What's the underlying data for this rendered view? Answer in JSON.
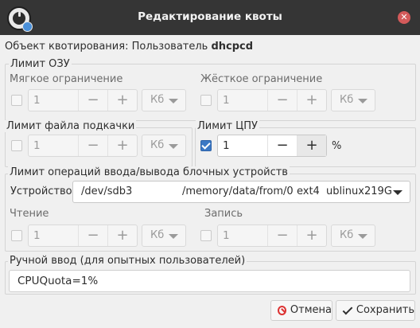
{
  "window": {
    "title": "Редактирование квоты"
  },
  "object": {
    "label": "Объект квотирования: Пользователь",
    "user": "dhcpcd"
  },
  "ram": {
    "title": "Лимит ОЗУ",
    "soft": {
      "label": "Мягкое ограничение",
      "checked": false,
      "value": "1",
      "unit": "Кб"
    },
    "hard": {
      "label": "Жёсткое ограничение",
      "checked": false,
      "value": "1",
      "unit": "Кб"
    }
  },
  "swap": {
    "title": "Лимит файла подкачки",
    "checked": false,
    "value": "1",
    "unit": "Кб"
  },
  "cpu": {
    "title": "Лимит ЦПУ",
    "checked": true,
    "value": "1",
    "unit": "%"
  },
  "io": {
    "title": "Лимит операций ввода/вывода блочных устройств",
    "device_label": "Устройство:",
    "device": {
      "name": "/dev/sdb3",
      "mount": "/memory/data/from/0",
      "fs": "ext4",
      "label": "ublinux",
      "size": "219G"
    },
    "read": {
      "label": "Чтение",
      "checked": false,
      "value": "1",
      "unit": "Кб"
    },
    "write": {
      "label": "Запись",
      "checked": false,
      "value": "1",
      "unit": "Кб"
    }
  },
  "manual": {
    "title": "Ручной ввод (для опытных пользователей)",
    "value": "CPUQuota=1%"
  },
  "buttons": {
    "cancel": "Отмена",
    "save": "Сохранить"
  },
  "spin": {
    "minus": "−",
    "plus": "+"
  },
  "colors": {
    "titlebar": "#353535",
    "accent": "#3b78c4",
    "cancel": "#dd3333"
  }
}
